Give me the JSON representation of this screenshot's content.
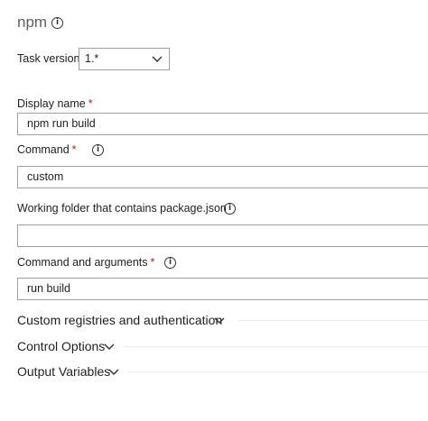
{
  "title": "npm",
  "task_version": {
    "label": "Task version",
    "value": "1.*"
  },
  "display_name": {
    "label": "Display name",
    "required": "*",
    "value": "npm run build"
  },
  "command": {
    "label": "Command",
    "required": "*",
    "value": "custom"
  },
  "working_folder": {
    "label": "Working folder that contains package.json",
    "value": ""
  },
  "command_args": {
    "label": "Command and arguments",
    "required": "*",
    "value": "run build"
  },
  "sections": {
    "custom_registries": "Custom registries and authentication",
    "control_options": "Control Options",
    "output_variables": "Output Variables"
  },
  "info_glyph": "i",
  "colors": {
    "required": "#a4262c",
    "border": "#a19f9d",
    "title": "#605e5c"
  }
}
